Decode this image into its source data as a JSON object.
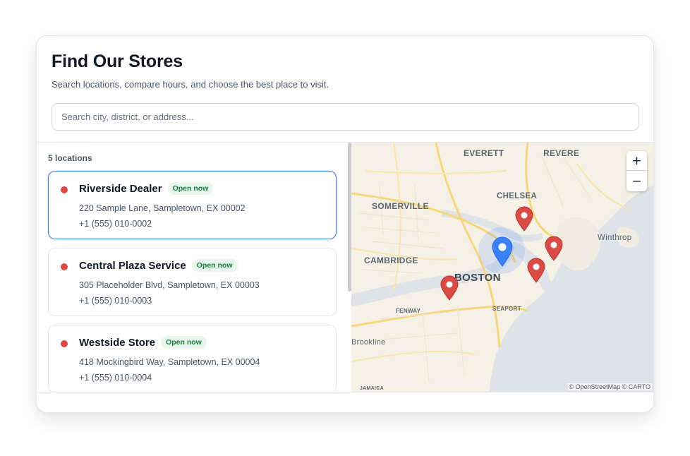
{
  "header": {
    "title": "Find Our Stores",
    "subtitle": "Search locations, compare hours, and choose the best place to visit.",
    "search_placeholder": "Search city, district, or address...",
    "search_value": ""
  },
  "list": {
    "count_label": "5 locations",
    "stores": [
      {
        "name": "Riverside Dealer",
        "status": "Open now",
        "address": "220 Sample Lane, Sampletown, EX 00002",
        "phone": "+1 (555) 010-0002",
        "selected": true
      },
      {
        "name": "Central Plaza Service",
        "status": "Open now",
        "address": "305 Placeholder Blvd, Sampletown, EX 00003",
        "phone": "+1 (555) 010-0003",
        "selected": false
      },
      {
        "name": "Westside Store",
        "status": "Open now",
        "address": "418 Mockingbird Way, Sampletown, EX 00004",
        "phone": "+1 (555) 010-0004",
        "selected": false
      }
    ]
  },
  "map": {
    "labels": {
      "everett": "EVERETT",
      "revere": "REVERE",
      "chelsea": "CHELSEA",
      "somerville": "SOMERVILLE",
      "winthrop": "Winthrop",
      "cambridge": "CAMBRIDGE",
      "boston": "BOSTON",
      "fenway": "FENWAY",
      "seaport": "SEAPORT",
      "brookline": "Brookline",
      "jamaica": "JAMAICA"
    },
    "zoom_in": "+",
    "zoom_out": "−",
    "attribution": "© OpenStreetMap © CARTO",
    "marker_icon": "map-pin-icon"
  },
  "colors": {
    "accent": "#3b82f6",
    "store_marker": "#dc4a45",
    "status_dot": "#dc4a45",
    "open_badge_text": "#15803d",
    "open_badge_bg": "#e8f5ec",
    "water": "#dde3e6",
    "land": "#f6f1e7"
  }
}
